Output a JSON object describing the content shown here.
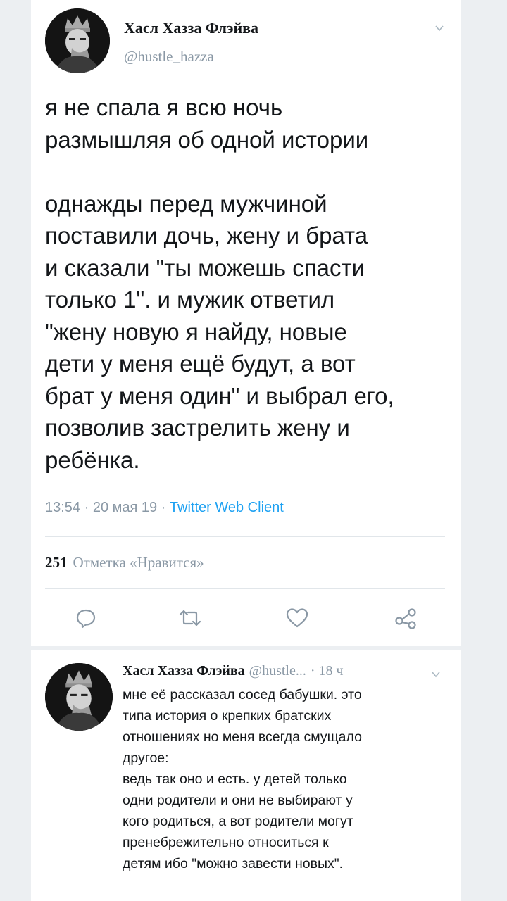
{
  "tweet": {
    "author_name": "Хасл Хазза Флэйва",
    "author_handle": "@hustle_hazza",
    "text": "я не спала я всю ночь\nразмышляя об одной истории\n\nоднажды перед мужчиной\nпоставили дочь, жену и брата\nи сказали \"ты можешь спасти\nтолько 1\". и мужик ответил\n\"жену новую я найду, новые\nдети у меня ещё будут, а вот\nбрат у меня один\" и выбрал его,\nпозволив застрелить жену и\nребёнка.",
    "timestamp": "13:54 · 20 мая 19 · ",
    "client": "Twitter Web Client",
    "likes_count": "251",
    "likes_label": "Отметка «Нравится»"
  },
  "actions": {
    "icons": [
      "reply-icon",
      "retweet-icon",
      "like-icon",
      "share-icon"
    ]
  },
  "reply": {
    "author_name": "Хасл Хазза Флэйва",
    "author_handle": "@hustle...",
    "time": "· 18 ч",
    "text": "мне её рассказал сосед бабушки. это\nтипа история о крепких братских\nотношениях но меня всегда смущало\nдругое:\nведь так оно и есть. у детей только\nодни родители и они не выбирают у\nкого родиться, а вот родители могут\nпренебрежительно относиться к\nдетям ибо \"можно завести новых\"."
  },
  "colors": {
    "text": "#14171a",
    "secondary": "#8a98a5",
    "link": "#1da1f2",
    "background": "#eceff2"
  }
}
